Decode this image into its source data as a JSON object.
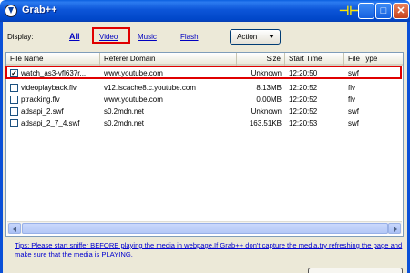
{
  "window": {
    "title": "Grab++",
    "icons": {
      "app": "download-icon",
      "pin": "pin-icon",
      "minimize": "minimize-icon",
      "maximize": "maximize-icon",
      "close": "close-icon"
    }
  },
  "toolbar": {
    "display_label": "Display:",
    "filters": [
      "All",
      "Video",
      "Music",
      "Flash"
    ],
    "selected_filter": "Video",
    "action_label": "Action"
  },
  "list": {
    "columns": [
      "File Name",
      "Referer Domain",
      "Size",
      "Start Time",
      "File Type"
    ],
    "rows": [
      {
        "checked": true,
        "name": "watch_as3-vfl637r...",
        "domain": "www.youtube.com",
        "size": "Unknown",
        "time": "12:20:50",
        "type": "swf"
      },
      {
        "checked": false,
        "name": "videoplayback.flv",
        "domain": "v12.lscache8.c.youtube.com",
        "size": "8.13MB",
        "time": "12:20:52",
        "type": "flv"
      },
      {
        "checked": false,
        "name": "ptracking.flv",
        "domain": "www.youtube.com",
        "size": "0.00MB",
        "time": "12:20:52",
        "type": "flv"
      },
      {
        "checked": false,
        "name": "adsapi_2.swf",
        "domain": "s0.2mdn.net",
        "size": "Unknown",
        "time": "12:20:52",
        "type": "swf"
      },
      {
        "checked": false,
        "name": "adsapi_2_7_4.swf",
        "domain": "s0.2mdn.net",
        "size": "163.51KB",
        "time": "12:20:53",
        "type": "swf"
      }
    ]
  },
  "tips": "Tips: Please start sniffer BEFORE playing the media in webpage.If Grab++ don't capture the media,try refreshing the page and make sure that the media is PLAYING.",
  "colors": {
    "highlight": "#e00000",
    "link": "#0000c0",
    "titlebar": "#0a50d8"
  }
}
